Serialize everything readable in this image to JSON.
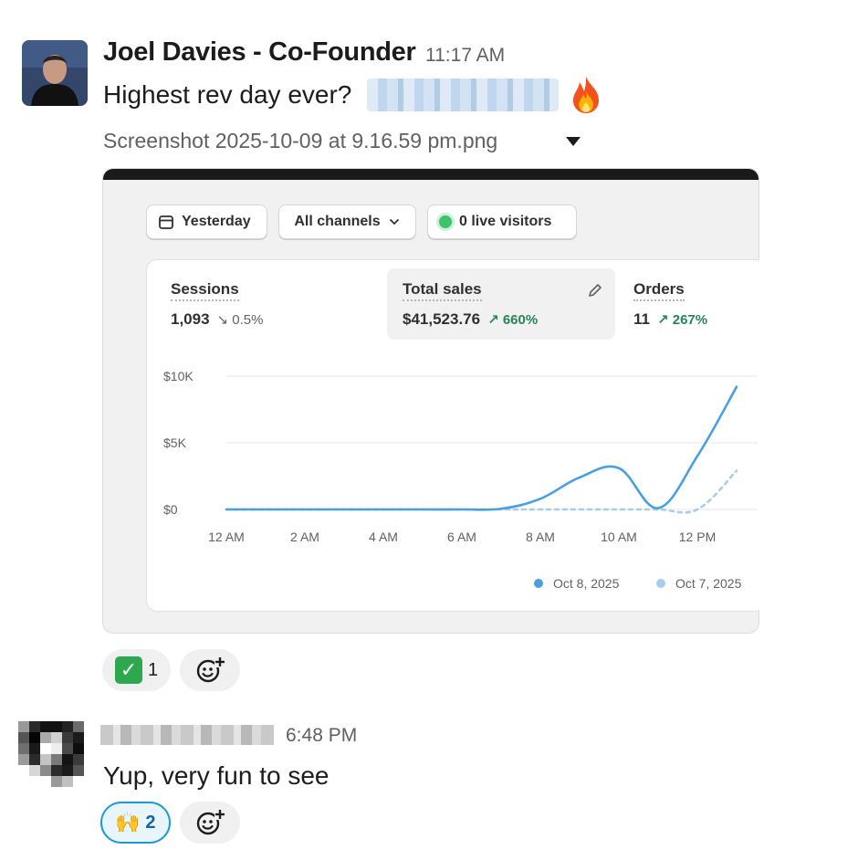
{
  "message1": {
    "author": "Joel Davies - Co-Founder",
    "time": "11:17 AM",
    "text": "Highest rev day ever?",
    "attachment": {
      "filename": "Screenshot 2025-10-09 at 9.16.59 pm.png",
      "filters": {
        "date": "Yesterday",
        "channels": "All channels",
        "visitors": "0 live visitors"
      },
      "metrics": [
        {
          "title": "Sessions",
          "value": "1,093",
          "change": "0.5%",
          "direction": "down"
        },
        {
          "title": "Total sales",
          "value": "$41,523.76",
          "change": "660%",
          "direction": "up"
        },
        {
          "title": "Orders",
          "value": "11",
          "change": "267%",
          "direction": "up"
        }
      ],
      "chart_data": {
        "type": "line",
        "x": [
          "12 AM",
          "1 AM",
          "2 AM",
          "3 AM",
          "4 AM",
          "5 AM",
          "6 AM",
          "7 AM",
          "8 AM",
          "9 AM",
          "10 AM",
          "11 AM",
          "12 PM",
          "1 PM"
        ],
        "x_tick_labels": [
          "12 AM",
          "2 AM",
          "4 AM",
          "6 AM",
          "8 AM",
          "10 AM",
          "12 PM"
        ],
        "y_tick_labels": [
          "$10K",
          "$5K",
          "$0"
        ],
        "ylim": [
          0,
          10000
        ],
        "series": [
          {
            "name": "Oct 8, 2025",
            "color": "#4a9fe0",
            "style": "solid",
            "values": [
              0,
              0,
              0,
              0,
              0,
              0,
              0,
              50,
              800,
              2400,
              3100,
              100,
              4000,
              9200
            ]
          },
          {
            "name": "Oct 7, 2025",
            "color": "#a9cde8",
            "style": "dashed",
            "values": [
              0,
              0,
              0,
              0,
              0,
              0,
              0,
              0,
              0,
              0,
              0,
              0,
              0,
              2900
            ]
          }
        ],
        "legend_position": "bottom-right",
        "grid": true
      }
    },
    "reactions": [
      {
        "emoji": "check-mark-emoji",
        "count": "1"
      }
    ]
  },
  "message2": {
    "time": "6:48 PM",
    "text": "Yup, very fun to see",
    "reactions": [
      {
        "emoji": "raised-hands-emoji",
        "glyph": "🙌",
        "count": "2"
      }
    ]
  }
}
